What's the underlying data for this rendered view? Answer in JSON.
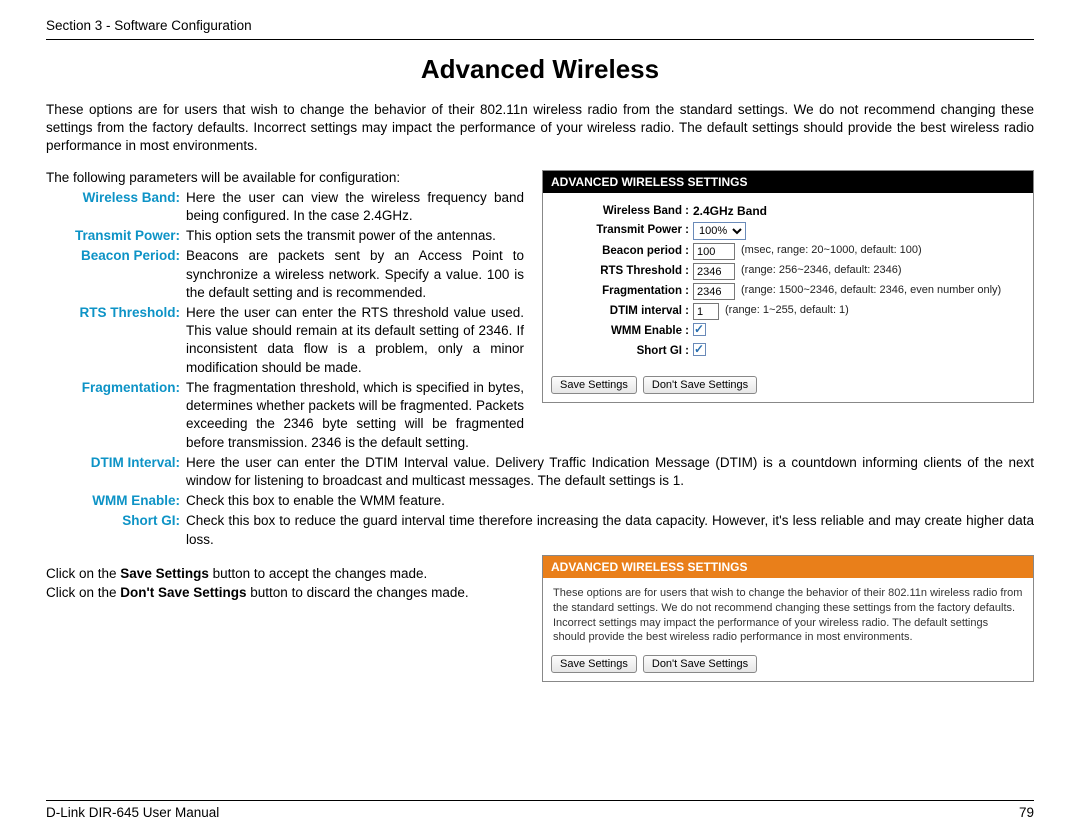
{
  "header": {
    "section": "Section 3 - Software Configuration"
  },
  "title": "Advanced Wireless",
  "intro": "These options are for users that wish to change the behavior of their 802.11n wireless radio from the standard settings. We do not recommend changing these settings from the factory defaults. Incorrect settings may impact the performance of your wireless radio. The default settings should provide the best wireless radio performance in most environments.",
  "param_intro": "The following parameters will be available for configuration:",
  "params": {
    "p0": {
      "label": "Wireless Band:",
      "desc": "Here the user can view the wireless frequency band being configured. In the case 2.4GHz."
    },
    "p1": {
      "label": "Transmit Power:",
      "desc": "This option sets the transmit power of the antennas."
    },
    "p2": {
      "label": "Beacon Period:",
      "desc": "Beacons are packets sent by an Access Point to synchronize a wireless network. Specify a value. 100 is the default setting and is recommended."
    },
    "p3": {
      "label": "RTS Threshold:",
      "desc": "Here the user can enter the RTS threshold value used. This value should remain at its default setting of 2346. If inconsistent data flow is a problem, only a minor modification should be made."
    },
    "p4": {
      "label": "Fragmentation:",
      "desc": "The fragmentation threshold, which is specified in bytes, determines whether packets will be fragmented. Packets exceeding the 2346 byte setting will be fragmented before transmission. 2346 is the default setting."
    },
    "p5": {
      "label": "DTIM Interval:",
      "desc": "Here the user can enter the DTIM Interval value. Delivery Traffic Indication Message (DTIM) is a countdown informing clients of the next window for listening to broadcast and multicast messages. The default settings is 1."
    },
    "p6": {
      "label": "WMM Enable:",
      "desc": "Check this box to enable the WMM feature."
    },
    "p7": {
      "label": "Short GI:",
      "desc": "Check this box to reduce the guard interval time therefore increasing the data capacity. However, it's less reliable and may create higher data loss."
    }
  },
  "save_note": {
    "line1a": "Click on the ",
    "line1b": "Save Settings",
    "line1c": " button to accept the changes made.",
    "line2a": "Click on the ",
    "line2b": "Don't Save Settings",
    "line2c": " button to discard the changes made."
  },
  "panel1": {
    "title": "ADVANCED WIRELESS SETTINGS",
    "rows": {
      "band": {
        "label": "Wireless Band :",
        "value": "2.4GHz Band"
      },
      "tx": {
        "label": "Transmit Power :",
        "value": "100%"
      },
      "beacon": {
        "label": "Beacon period :",
        "value": "100",
        "hint": "(msec, range: 20~1000, default: 100)"
      },
      "rts": {
        "label": "RTS Threshold :",
        "value": "2346",
        "hint": "(range: 256~2346, default: 2346)"
      },
      "frag": {
        "label": "Fragmentation :",
        "value": "2346",
        "hint": "(range: 1500~2346, default: 2346, even number only)"
      },
      "dtim": {
        "label": "DTIM interval :",
        "value": "1",
        "hint": "(range: 1~255, default: 1)"
      },
      "wmm": {
        "label": "WMM Enable :"
      },
      "sgi": {
        "label": "Short GI :"
      }
    },
    "save": "Save Settings",
    "cancel": "Don't Save Settings"
  },
  "panel2": {
    "title": "ADVANCED WIRELESS SETTINGS",
    "info": "These options are for users that wish to change the behavior of their 802.11n wireless radio from the standard settings. We do not recommend changing these settings from the factory defaults. Incorrect settings may impact the performance of your wireless radio. The default settings should provide the best wireless radio performance in most environments.",
    "save": "Save Settings",
    "cancel": "Don't Save Settings"
  },
  "footer": {
    "left": "D-Link DIR-645 User Manual",
    "right": "79"
  }
}
